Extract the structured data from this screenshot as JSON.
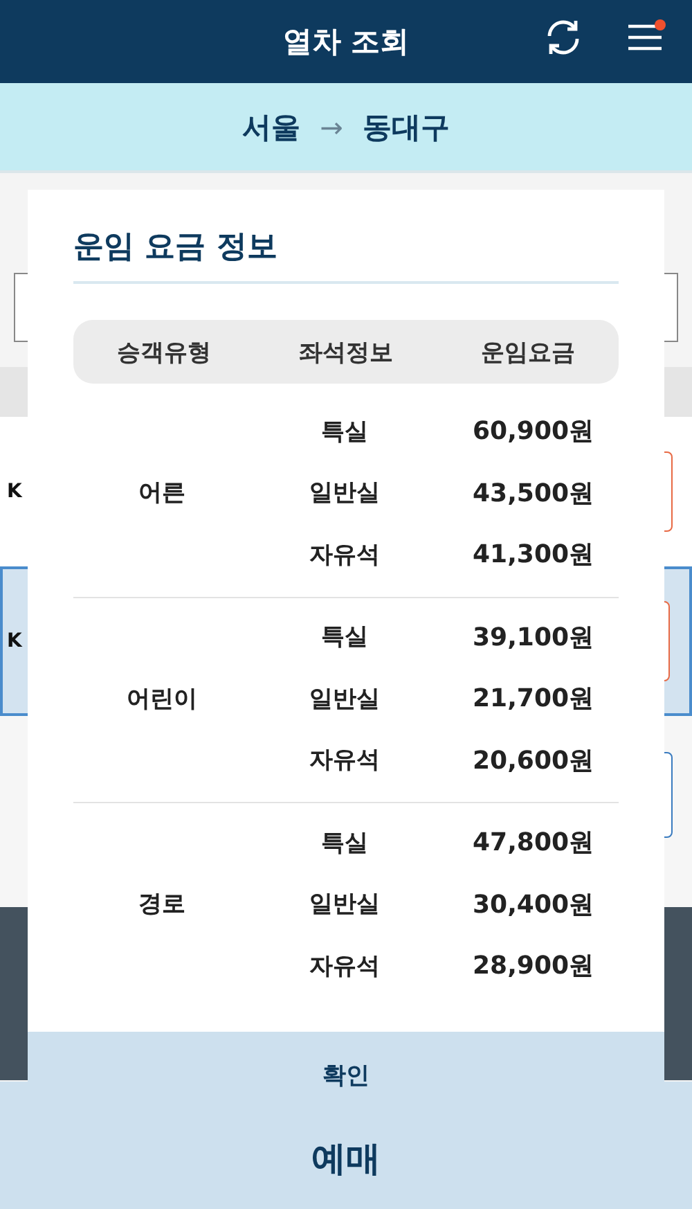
{
  "header": {
    "title": "열차 조회"
  },
  "route": {
    "from": "서울",
    "arrow": "→",
    "to": "동대구"
  },
  "trains": [
    {
      "label": "K",
      "selected": false
    },
    {
      "label": "K",
      "selected": true
    }
  ],
  "booking_button": "예매",
  "fare_dialog": {
    "title": "운임 요금 정보",
    "columns": [
      "승객유형",
      "좌석정보",
      "운임요금"
    ],
    "groups": [
      {
        "passenger": "어른",
        "fares": [
          {
            "seat": "특실",
            "price": "60,900원"
          },
          {
            "seat": "일반실",
            "price": "43,500원"
          },
          {
            "seat": "자유석",
            "price": "41,300원"
          }
        ]
      },
      {
        "passenger": "어린이",
        "fares": [
          {
            "seat": "특실",
            "price": "39,100원"
          },
          {
            "seat": "일반실",
            "price": "21,700원"
          },
          {
            "seat": "자유석",
            "price": "20,600원"
          }
        ]
      },
      {
        "passenger": "경로",
        "fares": [
          {
            "seat": "특실",
            "price": "47,800원"
          },
          {
            "seat": "일반실",
            "price": "30,400원"
          },
          {
            "seat": "자유석",
            "price": "28,900원"
          }
        ]
      }
    ],
    "confirm": "확인"
  }
}
